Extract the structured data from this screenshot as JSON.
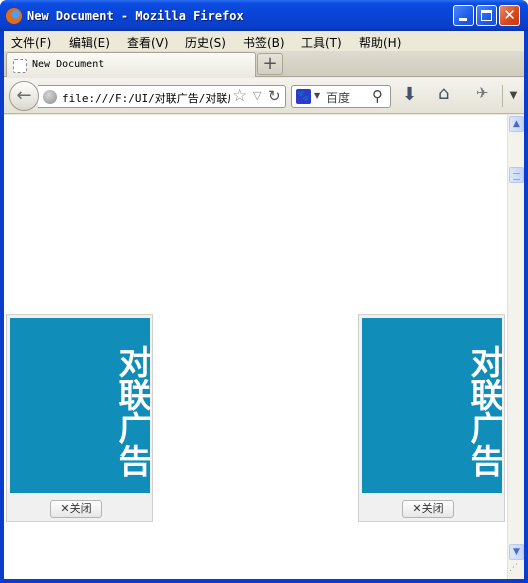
{
  "window": {
    "title": "New Document - Mozilla Firefox",
    "minimize_glyph": "",
    "close_glyph": "✕"
  },
  "menubar": {
    "items": [
      {
        "label": "文件(F)"
      },
      {
        "label": "编辑(E)"
      },
      {
        "label": "查看(V)"
      },
      {
        "label": "历史(S)"
      },
      {
        "label": "书签(B)"
      },
      {
        "label": "工具(T)"
      },
      {
        "label": "帮助(H)"
      }
    ]
  },
  "tabs": {
    "active_label": "New Document",
    "new_tab_glyph": "+"
  },
  "navbar": {
    "back_glyph": "←",
    "url": "file:///F:/UI/对联广告/对联广告.html",
    "bookmark_glyph": "☆",
    "dropmark_glyph": "▽",
    "reload_glyph": "↻",
    "search_engine_glyph": "🐾",
    "search_engine_drop": "▼",
    "search_placeholder": "百度",
    "search_glyph": "⚲",
    "download_glyph": "⬇",
    "home_glyph": "⌂",
    "addon_glyph": "✈",
    "menu_drop_glyph": "▼"
  },
  "scrollbar": {
    "up_glyph": "▲",
    "down_glyph": "▼",
    "grip_glyph": "⋰"
  },
  "ads": {
    "left": {
      "text": "对联广告",
      "close_label": "✕关闭"
    },
    "right": {
      "text": "对联广告",
      "close_label": "✕关闭"
    }
  },
  "colors": {
    "ad_banner": "#118DBA",
    "titlebar": "#0A44D6",
    "chrome": "#ECE9D8"
  }
}
